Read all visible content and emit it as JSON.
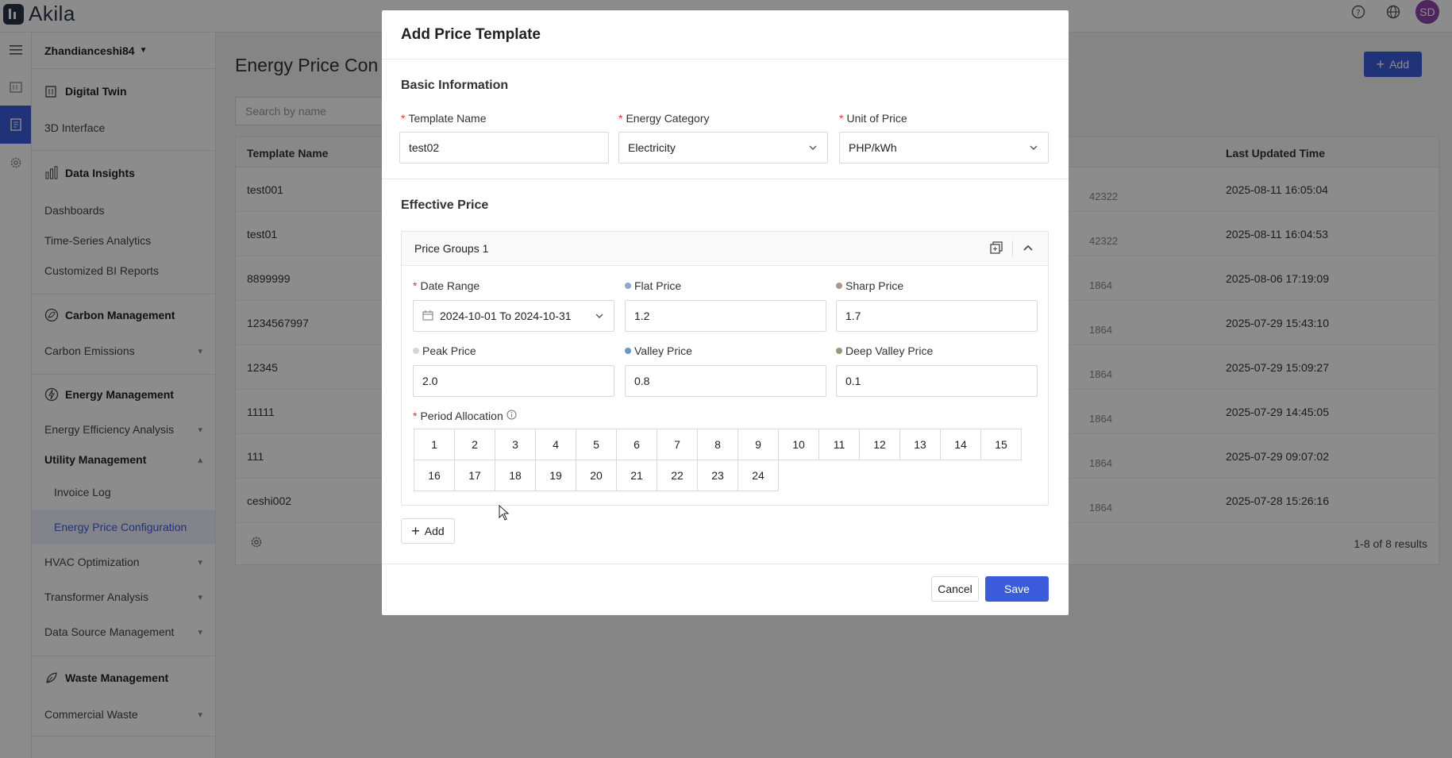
{
  "app": {
    "logo_text": "Akila",
    "avatar_initials": "SD"
  },
  "sidebar": {
    "site": "Zhandianceshi84",
    "sections": [
      {
        "title": "Digital Twin",
        "items": [
          "3D Interface"
        ]
      },
      {
        "title": "Data Insights",
        "items": [
          "Dashboards",
          "Time-Series Analytics",
          "Customized BI Reports"
        ]
      },
      {
        "title": "Carbon Management",
        "items": [
          "Carbon Emissions"
        ]
      },
      {
        "title": "Energy Management",
        "items": [
          "Energy Efficiency Analysis",
          "Utility Management",
          "Invoice Log",
          "Energy Price Configuration",
          "HVAC Optimization",
          "Transformer Analysis",
          "Data Source Management"
        ]
      },
      {
        "title": "Waste Management",
        "items": [
          "Commercial Waste"
        ]
      }
    ]
  },
  "main": {
    "title": "Energy Price Con",
    "add_label": "Add",
    "search_placeholder": "Search by name",
    "columns": {
      "name": "Template Name",
      "updated": "Last Updated Time"
    },
    "rows": [
      {
        "name": "test001",
        "mid": "42322",
        "updated": "2025-08-11 16:05:04"
      },
      {
        "name": "test01",
        "mid": "42322",
        "updated": "2025-08-11 16:04:53"
      },
      {
        "name": "8899999",
        "mid": "1864",
        "updated": "2025-08-06 17:19:09"
      },
      {
        "name": "1234567997",
        "mid": "1864",
        "updated": "2025-07-29 15:43:10"
      },
      {
        "name": "12345",
        "mid": "1864",
        "updated": "2025-07-29 15:09:27"
      },
      {
        "name": "11111",
        "mid": "1864",
        "updated": "2025-07-29 14:45:05"
      },
      {
        "name": "111",
        "mid": "1864",
        "updated": "2025-07-29 09:07:02"
      },
      {
        "name": "ceshi002",
        "mid": "1864",
        "updated": "2025-07-28 15:26:16"
      }
    ],
    "results": "1-8 of 8 results"
  },
  "modal": {
    "title": "Add Price Template",
    "basic_title": "Basic Information",
    "template_name": {
      "label": "Template Name",
      "value": "test02"
    },
    "energy_category": {
      "label": "Energy Category",
      "value": "Electricity"
    },
    "unit_of_price": {
      "label": "Unit of Price",
      "value": "PHP/kWh"
    },
    "effective_title": "Effective Price",
    "group": {
      "title": "Price Groups 1",
      "date_range": {
        "label": "Date Range",
        "value": "2024-10-01 To 2024-10-31"
      },
      "flat_price": {
        "label": "Flat Price",
        "value": "1.2",
        "dot_color": "#8fa8c8"
      },
      "sharp_price": {
        "label": "Sharp Price",
        "value": "1.7",
        "dot_color": "#a89a8a"
      },
      "peak_price": {
        "label": "Peak Price",
        "value": "2.0",
        "dot_color": "#d6d6d6"
      },
      "valley_price": {
        "label": "Valley Price",
        "value": "0.8",
        "dot_color": "#6a98c0"
      },
      "deep_valley_price": {
        "label": "Deep Valley Price",
        "value": "0.1",
        "dot_color": "#9a9a7a"
      },
      "period_label": "Period Allocation",
      "periods_row1": [
        "1",
        "2",
        "3",
        "4",
        "5",
        "6",
        "7",
        "8",
        "9",
        "10",
        "11",
        "12",
        "13",
        "14",
        "15"
      ],
      "periods_row2": [
        "16",
        "17",
        "18",
        "19",
        "20",
        "21",
        "22",
        "23",
        "24"
      ]
    },
    "add_label": "Add",
    "cancel_label": "Cancel",
    "save_label": "Save"
  },
  "colors": {
    "primary": "#3b5bdb",
    "required": "#e03131",
    "avatar": "#8e44ad"
  }
}
